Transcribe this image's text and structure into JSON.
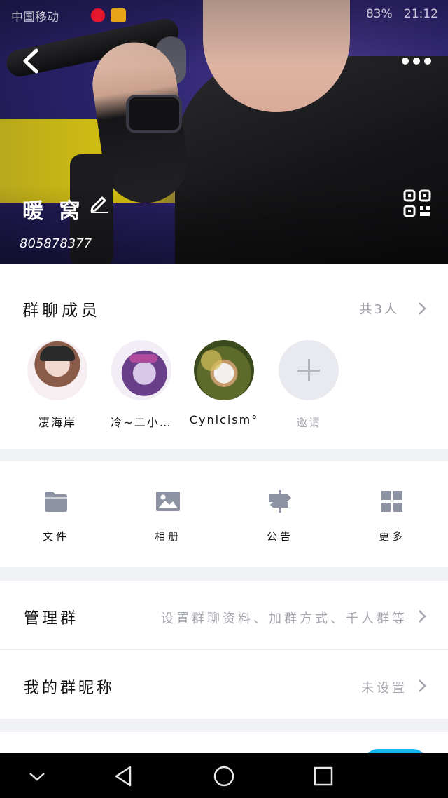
{
  "status_bar": {
    "carrier": "中国移动",
    "time": "21:12",
    "battery": "83%"
  },
  "header": {
    "back_icon": "chevron-left-icon",
    "more_icon": "more-dots-icon",
    "group_name": "暖 窝",
    "group_id": "805878377",
    "edit_icon": "pencil-icon",
    "qr_icon": "qr-code-icon"
  },
  "members": {
    "title": "群聊成员",
    "count_label": "共3人",
    "items": [
      {
        "name": "凄海岸"
      },
      {
        "name": "冷~二小…"
      },
      {
        "name": "Cynicism°"
      }
    ],
    "invite_label": "邀请"
  },
  "tools": [
    {
      "label": "文件",
      "icon": "folder-icon"
    },
    {
      "label": "相册",
      "icon": "image-icon"
    },
    {
      "label": "公告",
      "icon": "signpost-icon"
    },
    {
      "label": "更多",
      "icon": "grid-icon"
    }
  ],
  "settings": {
    "manage": {
      "label": "管理群",
      "value": "设置群聊资料、加群方式、千人群等"
    },
    "nickname": {
      "label": "我的群昵称",
      "value": "未设置"
    }
  },
  "colors": {
    "accent": "#18b4f2",
    "icon_gray": "#8e93a3",
    "secondary_text": "#a6a8b0"
  }
}
